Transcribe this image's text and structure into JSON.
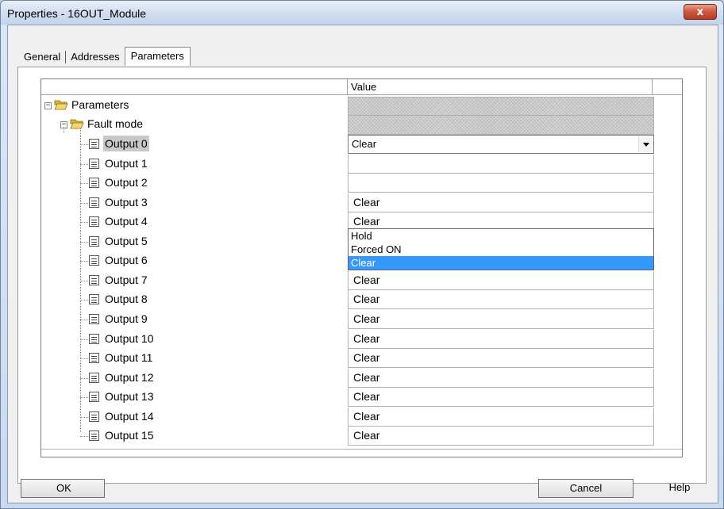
{
  "window": {
    "title": "Properties - 16OUT_Module",
    "close_glyph": "x"
  },
  "tabs": [
    {
      "label": "General",
      "active": false
    },
    {
      "label": "Addresses",
      "active": false
    },
    {
      "label": "Parameters",
      "active": true
    }
  ],
  "grid": {
    "value_header": "Value",
    "root_label": "Parameters",
    "group_label": "Fault mode",
    "outputs": [
      {
        "label": "Output 0",
        "value": "Clear"
      },
      {
        "label": "Output 1",
        "value": ""
      },
      {
        "label": "Output 2",
        "value": ""
      },
      {
        "label": "Output 3",
        "value": "Clear"
      },
      {
        "label": "Output 4",
        "value": "Clear"
      },
      {
        "label": "Output 5",
        "value": "Clear"
      },
      {
        "label": "Output 6",
        "value": "Clear"
      },
      {
        "label": "Output 7",
        "value": "Clear"
      },
      {
        "label": "Output 8",
        "value": "Clear"
      },
      {
        "label": "Output 9",
        "value": "Clear"
      },
      {
        "label": "Output 10",
        "value": "Clear"
      },
      {
        "label": "Output 11",
        "value": "Clear"
      },
      {
        "label": "Output 12",
        "value": "Clear"
      },
      {
        "label": "Output 13",
        "value": "Clear"
      },
      {
        "label": "Output 14",
        "value": "Clear"
      },
      {
        "label": "Output 15",
        "value": "Clear"
      }
    ],
    "dropdown_options": [
      "Hold",
      "Forced ON",
      "Clear"
    ],
    "dropdown_selected": "Clear"
  },
  "buttons": {
    "ok": "OK",
    "cancel": "Cancel",
    "help": "Help"
  },
  "colors": {
    "highlight": "#3399ff",
    "close": "#cc5a44"
  }
}
